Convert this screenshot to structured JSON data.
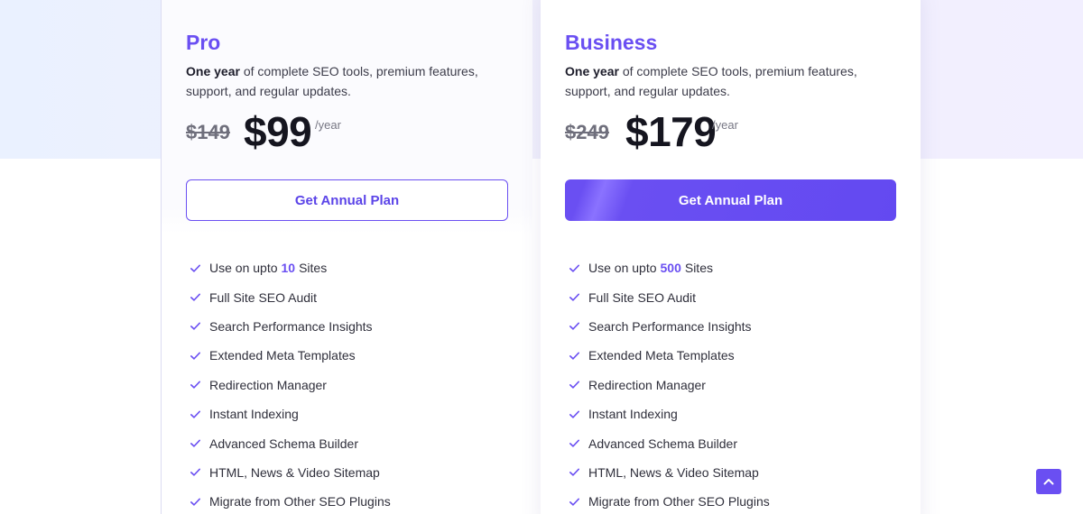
{
  "plans": [
    {
      "name": "Pro",
      "desc_bold": "One year",
      "desc_rest": " of complete SEO tools, premium features, support, and regular updates.",
      "old_price": "$149",
      "price": "$99",
      "per": "/year",
      "cta": "Get Annual Plan",
      "features": [
        {
          "pre": "Use on upto",
          "hl": "10",
          "post": "Sites"
        },
        {
          "pre": "Full Site SEO Audit"
        },
        {
          "pre": "Search Performance Insights"
        },
        {
          "pre": "Extended Meta Templates"
        },
        {
          "pre": "Redirection Manager"
        },
        {
          "pre": "Instant Indexing"
        },
        {
          "pre": "Advanced Schema Builder"
        },
        {
          "pre": "HTML, News & Video Sitemap"
        },
        {
          "pre": "Migrate from Other SEO Plugins"
        }
      ]
    },
    {
      "name": "Business",
      "desc_bold": "One year",
      "desc_rest": " of complete SEO tools, premium features, support, and regular updates.",
      "old_price": "$249",
      "price": "$179",
      "per": "/year",
      "cta": "Get Annual Plan",
      "features": [
        {
          "pre": "Use on upto",
          "hl": "500",
          "post": "Sites"
        },
        {
          "pre": "Full Site SEO Audit"
        },
        {
          "pre": "Search Performance Insights"
        },
        {
          "pre": "Extended Meta Templates"
        },
        {
          "pre": "Redirection Manager"
        },
        {
          "pre": "Instant Indexing"
        },
        {
          "pre": "Advanced Schema Builder"
        },
        {
          "pre": "HTML, News & Video Sitemap"
        },
        {
          "pre": "Migrate from Other SEO Plugins"
        }
      ]
    }
  ],
  "icons": {
    "check": "check-icon",
    "scroll_top": "chevron-up-icon"
  },
  "colors": {
    "accent": "#6a4ff2",
    "text": "#1d1d2b",
    "muted": "#6f6f7c"
  }
}
